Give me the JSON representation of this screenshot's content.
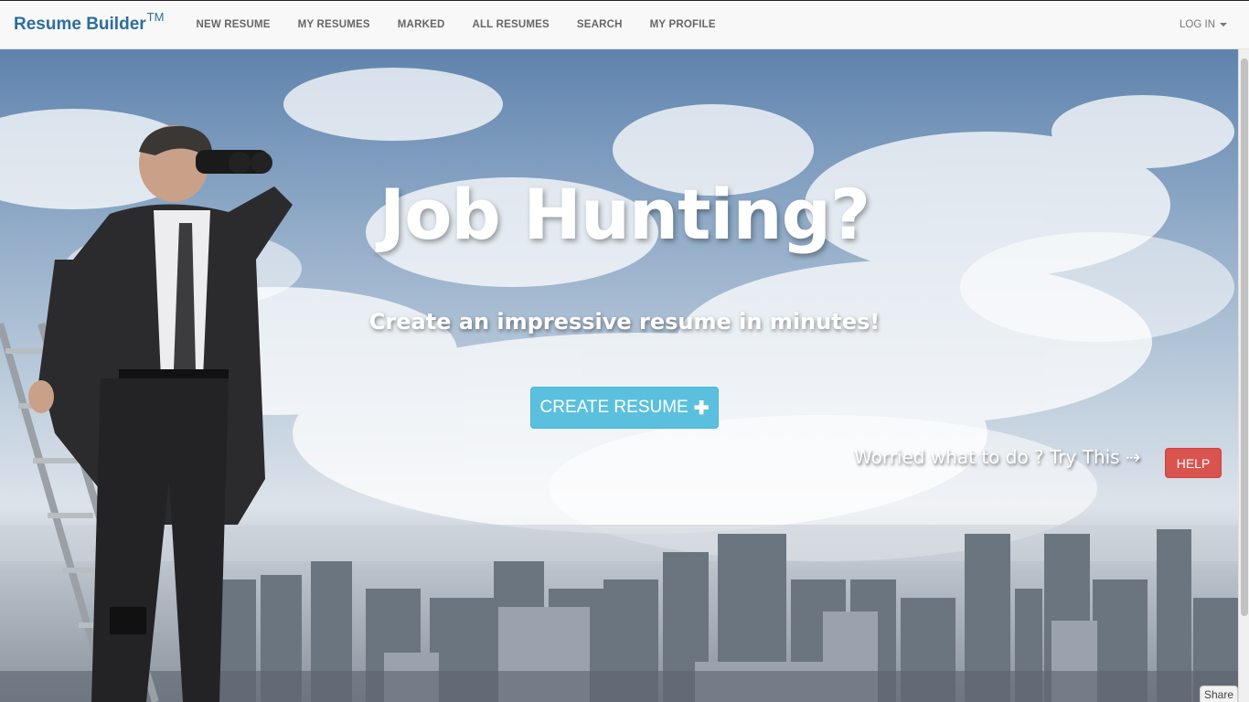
{
  "navbar": {
    "brand": "Resume Builder",
    "brand_tm": "TM",
    "links": [
      "NEW RESUME",
      "MY RESUMES",
      "MARKED",
      "ALL RESUMES",
      "SEARCH",
      "MY PROFILE"
    ],
    "login": "LOG IN"
  },
  "hero": {
    "headline": "Job Hunting?",
    "subline": "Create an impressive resume in minutes!",
    "create_button": "CREATE RESUME",
    "worried_text": "Worried what to do ? Try This ⇢",
    "help_button": "HELP"
  },
  "share_label": "Share",
  "colors": {
    "brand": "#2c6e9b",
    "create_button": "#5bc0de",
    "help_button": "#d9534f"
  },
  "icons": {
    "plus": "plus-icon",
    "caret": "caret-down-icon",
    "arrow": "arrow-right-icon"
  }
}
